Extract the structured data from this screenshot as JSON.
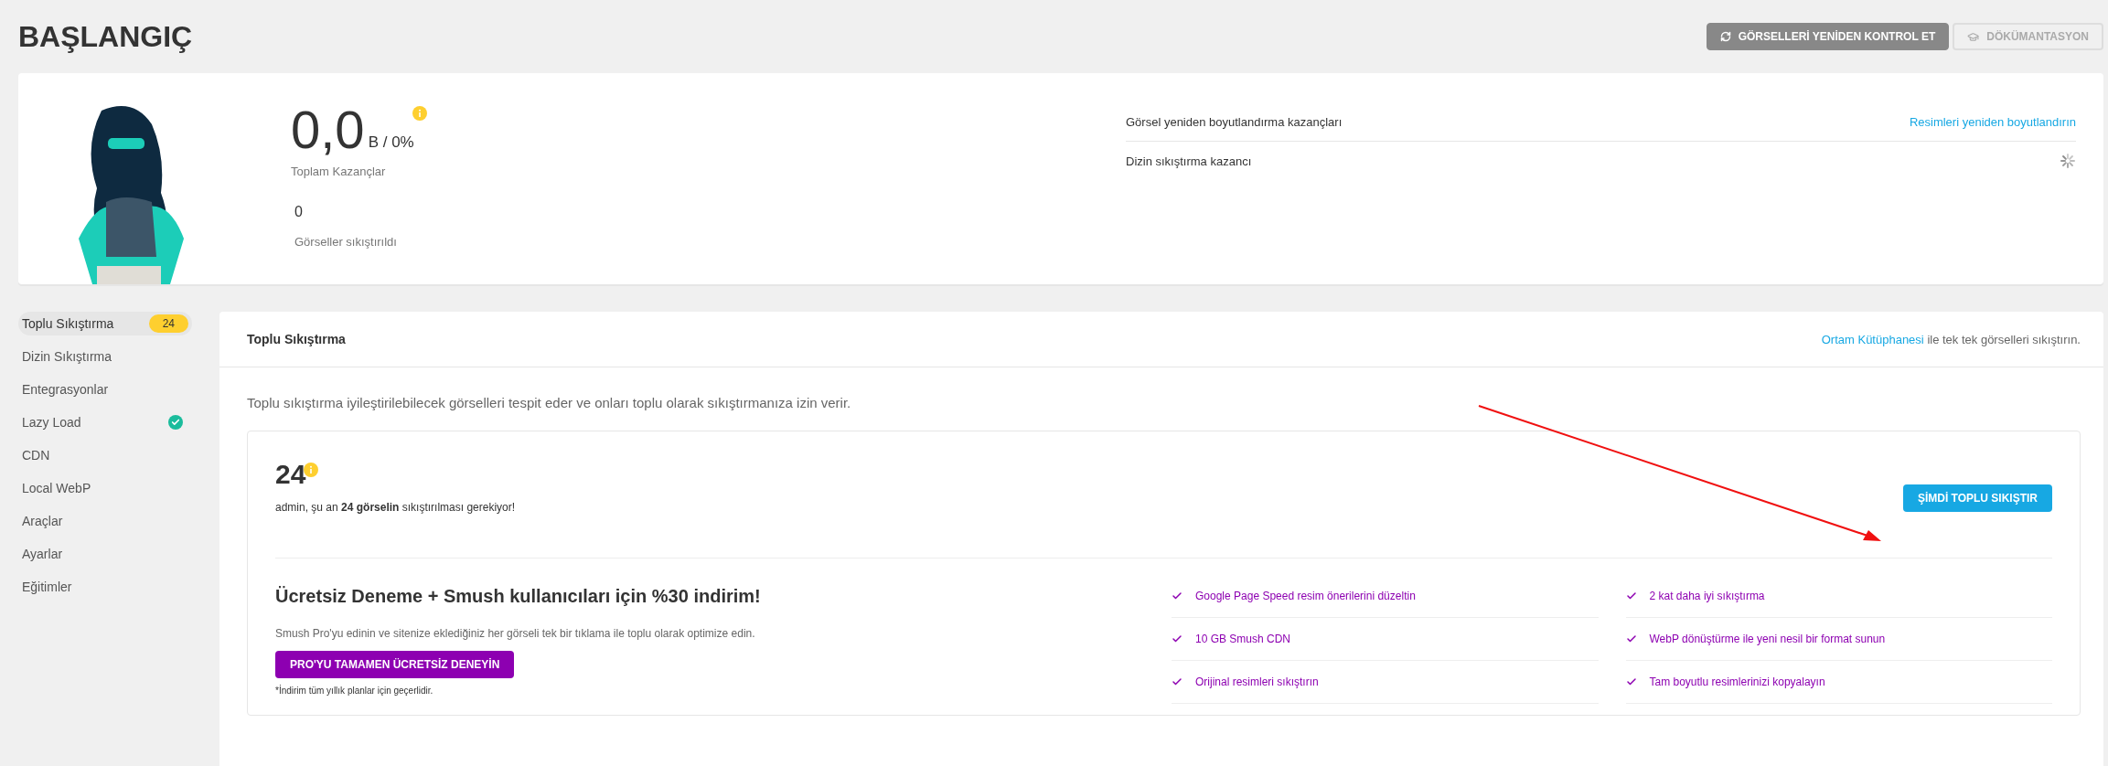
{
  "page": {
    "title": "BAŞLANGIÇ"
  },
  "header_buttons": [
    {
      "label": "GÖRSELLERİ YENİDEN KONTROL ET",
      "kind": "refresh"
    },
    {
      "label": "DÖKÜMANTASYON",
      "kind": "docs"
    }
  ],
  "summary": {
    "savings": "0,0",
    "savings_unit": "B / 0%",
    "savings_label": "Toplam Kazançlar",
    "compressed_count": "0",
    "compressed_label": "Görseller sıkıştırıldı",
    "rows": [
      {
        "label": "Görsel yeniden boyutlandırma kazançları",
        "kind": "link",
        "value": "Resimleri yeniden boyutlandırın"
      },
      {
        "label": "Dizin sıkıştırma kazancı",
        "kind": "loading"
      }
    ]
  },
  "sidebar": {
    "items": [
      {
        "label": "Toplu Sıkıştırma",
        "selected": true,
        "checked": false,
        "badge": "24"
      },
      {
        "label": "Dizin Sıkıştırma",
        "selected": false,
        "checked": false
      },
      {
        "label": "Entegrasyonlar",
        "selected": false,
        "checked": false
      },
      {
        "label": "Lazy Load",
        "selected": false,
        "checked": true
      },
      {
        "label": "CDN",
        "selected": false,
        "checked": false
      },
      {
        "label": "Local WebP",
        "selected": false,
        "checked": false
      },
      {
        "label": "Araçlar",
        "selected": false,
        "checked": false
      },
      {
        "label": "Ayarlar",
        "selected": false,
        "checked": false
      },
      {
        "label": "Eğitimler",
        "selected": false,
        "checked": false
      }
    ]
  },
  "panel": {
    "title": "Toplu Sıkıştırma",
    "note_link": "Ortam Kütüphanesi",
    "note_text": "ile tek tek görselleri sıkıştırın.",
    "description": "Toplu sıkıştırma iyileştirilebilecek görselleri tespit eder ve onları toplu olarak sıkıştırmanıza izin verir.",
    "pending_count": "24",
    "pending_text": "admin, şu an **24 görselin** sıkıştırılması gerekiyor!",
    "action": "ŞİMDİ TOPLU SIKIŞTIR",
    "promo": {
      "title": "Ücretsiz Deneme + Smush kullanıcıları için %30 indirim!",
      "text": "Smush Pro'yu edinin ve sitenize eklediğiniz her görseli tek bir tıklama ile toplu olarak optimize edin.",
      "button": "PRO'YU TAMAMEN ÜCRETSİZ DENEYİN",
      "footnote": "*İndirim tüm yıllık planlar için geçerlidir.",
      "features": [
        "Google Page Speed resim önerilerini düzeltin",
        "2 kat daha iyi sıkıştırma",
        "10 GB Smush CDN",
        "WebP dönüştürme ile yeni nesil bir format sunun",
        "Orijinal resimleri sıkıştırın",
        "Tam boyutlu resimlerinizi kopyalayın"
      ]
    }
  }
}
